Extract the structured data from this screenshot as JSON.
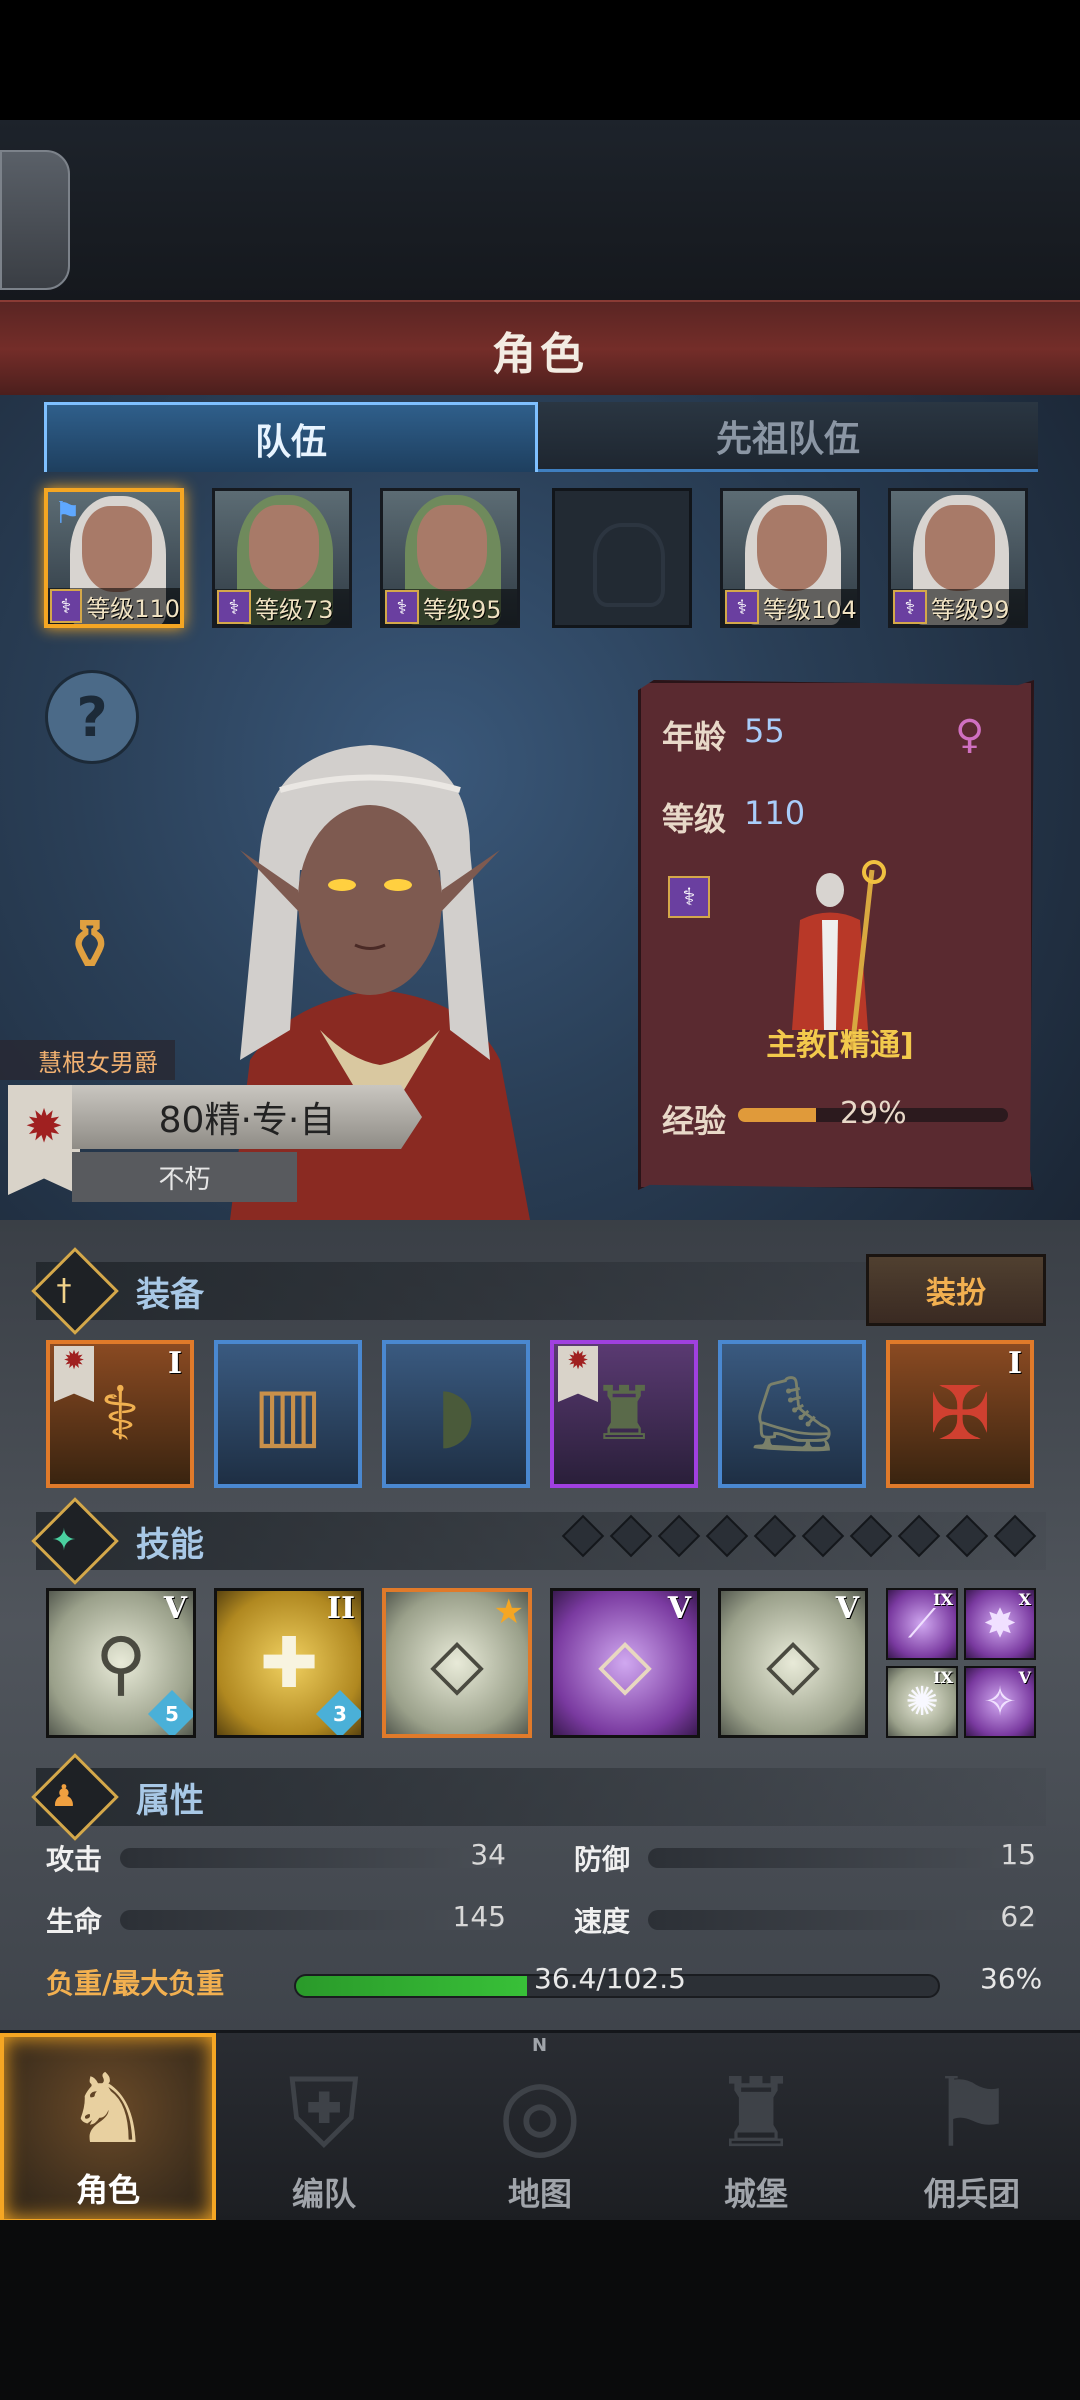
{
  "title": "角色",
  "tabs": {
    "team": "队伍",
    "ancestor_team": "先祖队伍"
  },
  "team": [
    {
      "level_text": "等级110",
      "hair": "white",
      "selected": true,
      "flag": true
    },
    {
      "level_text": "等级73",
      "hair": "white"
    },
    {
      "level_text": "等级95",
      "hair": "green"
    },
    {
      "level_text": "",
      "hair": "none",
      "empty": true
    },
    {
      "level_text": "等级104",
      "hair": "white"
    },
    {
      "level_text": "等级99",
      "hair": "white"
    }
  ],
  "character": {
    "name": "慧根女男爵",
    "rank": "80精·专·自",
    "status": "不朽",
    "age_label": "年龄",
    "age": "55",
    "level_label": "等级",
    "level": "110",
    "class_name": "主教[精通]",
    "exp_label": "经验",
    "exp_percent": "29%",
    "exp_fraction": 0.29
  },
  "sections": {
    "equipment": "装备",
    "skills": "技能",
    "attributes": "属性",
    "dress_button": "装扮"
  },
  "equipment": [
    {
      "rarity": "orange",
      "tier": "I",
      "icon": "staff-icon",
      "banner": true
    },
    {
      "rarity": "blue",
      "tier": "",
      "icon": "book-icon"
    },
    {
      "rarity": "blue",
      "tier": "",
      "icon": "hood-icon"
    },
    {
      "rarity": "purple",
      "tier": "",
      "icon": "robe-icon",
      "banner": true
    },
    {
      "rarity": "blue",
      "tier": "",
      "icon": "boots-icon"
    },
    {
      "rarity": "orange",
      "tier": "I",
      "icon": "amulet-icon"
    }
  ],
  "skill_pips_count": 10,
  "skills": [
    {
      "style": "grey",
      "roman": "V",
      "badge": "5",
      "icon": "spear-prayer-icon"
    },
    {
      "style": "gold",
      "roman": "II",
      "badge": "3",
      "icon": "holy-shield-icon"
    },
    {
      "style": "grey",
      "roman": "",
      "star": true,
      "icon": "crystal-prayer-icon"
    },
    {
      "style": "purple",
      "roman": "V",
      "icon": "crystal-hand-icon"
    },
    {
      "style": "grey",
      "roman": "V",
      "icon": "crystal-hand-icon"
    }
  ],
  "mini_skills": [
    {
      "roman": "IX",
      "style": "purple"
    },
    {
      "roman": "X",
      "style": "purple"
    },
    {
      "roman": "IX",
      "style": "grey"
    },
    {
      "roman": "V",
      "style": "purple"
    }
  ],
  "stats": {
    "attack_label": "攻击",
    "attack": "34",
    "defense_label": "防御",
    "defense": "15",
    "hp_label": "生命",
    "hp": "145",
    "speed_label": "速度",
    "speed": "62",
    "load_label": "负重/最大负重",
    "load": "36.4/102.5",
    "load_percent": "36%",
    "load_fraction": 0.36
  },
  "nav": [
    {
      "label": "角色",
      "active": true
    },
    {
      "label": "编队"
    },
    {
      "label": "地图",
      "compass": "N"
    },
    {
      "label": "城堡"
    },
    {
      "label": "佣兵团"
    }
  ],
  "colors": {
    "accent_orange": "#f5a623",
    "title_red": "#742d29",
    "tab_blue": "#7fc0ff",
    "xp_orange": "#e09a3a",
    "load_green": "#38c038"
  }
}
